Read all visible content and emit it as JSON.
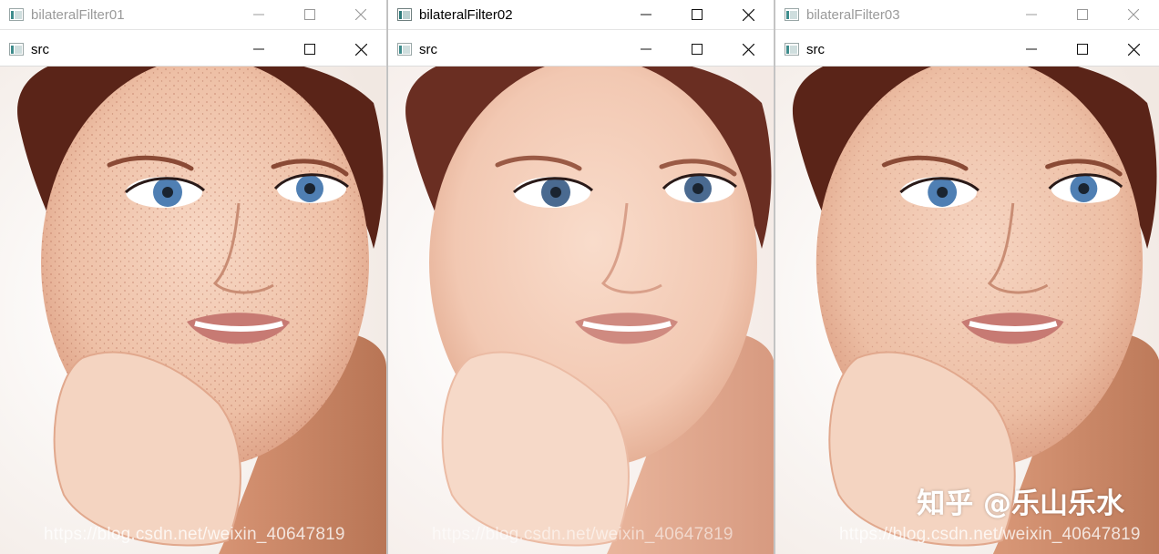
{
  "windows": [
    {
      "outer_title": "bilateralFilter01",
      "inner_title": "src",
      "outer_active": false,
      "smooth": "low"
    },
    {
      "outer_title": "bilateralFilter02",
      "inner_title": "src",
      "outer_active": true,
      "smooth": "high"
    },
    {
      "outer_title": "bilateralFilter03",
      "inner_title": "src",
      "outer_active": false,
      "smooth": "medium"
    }
  ],
  "watermark": "https://blog.csdn.net/weixin_40647819",
  "overlay_brand": "知乎 @乐山乐水",
  "colors": {
    "skin": "#f1c9b3",
    "skin_shadow": "#d79a80",
    "hair": "#5a2418",
    "iris": "#4f7fb3",
    "lips": "#c77a73"
  },
  "icons": [
    "app-window-icon",
    "minimize-icon",
    "maximize-icon",
    "close-icon"
  ]
}
